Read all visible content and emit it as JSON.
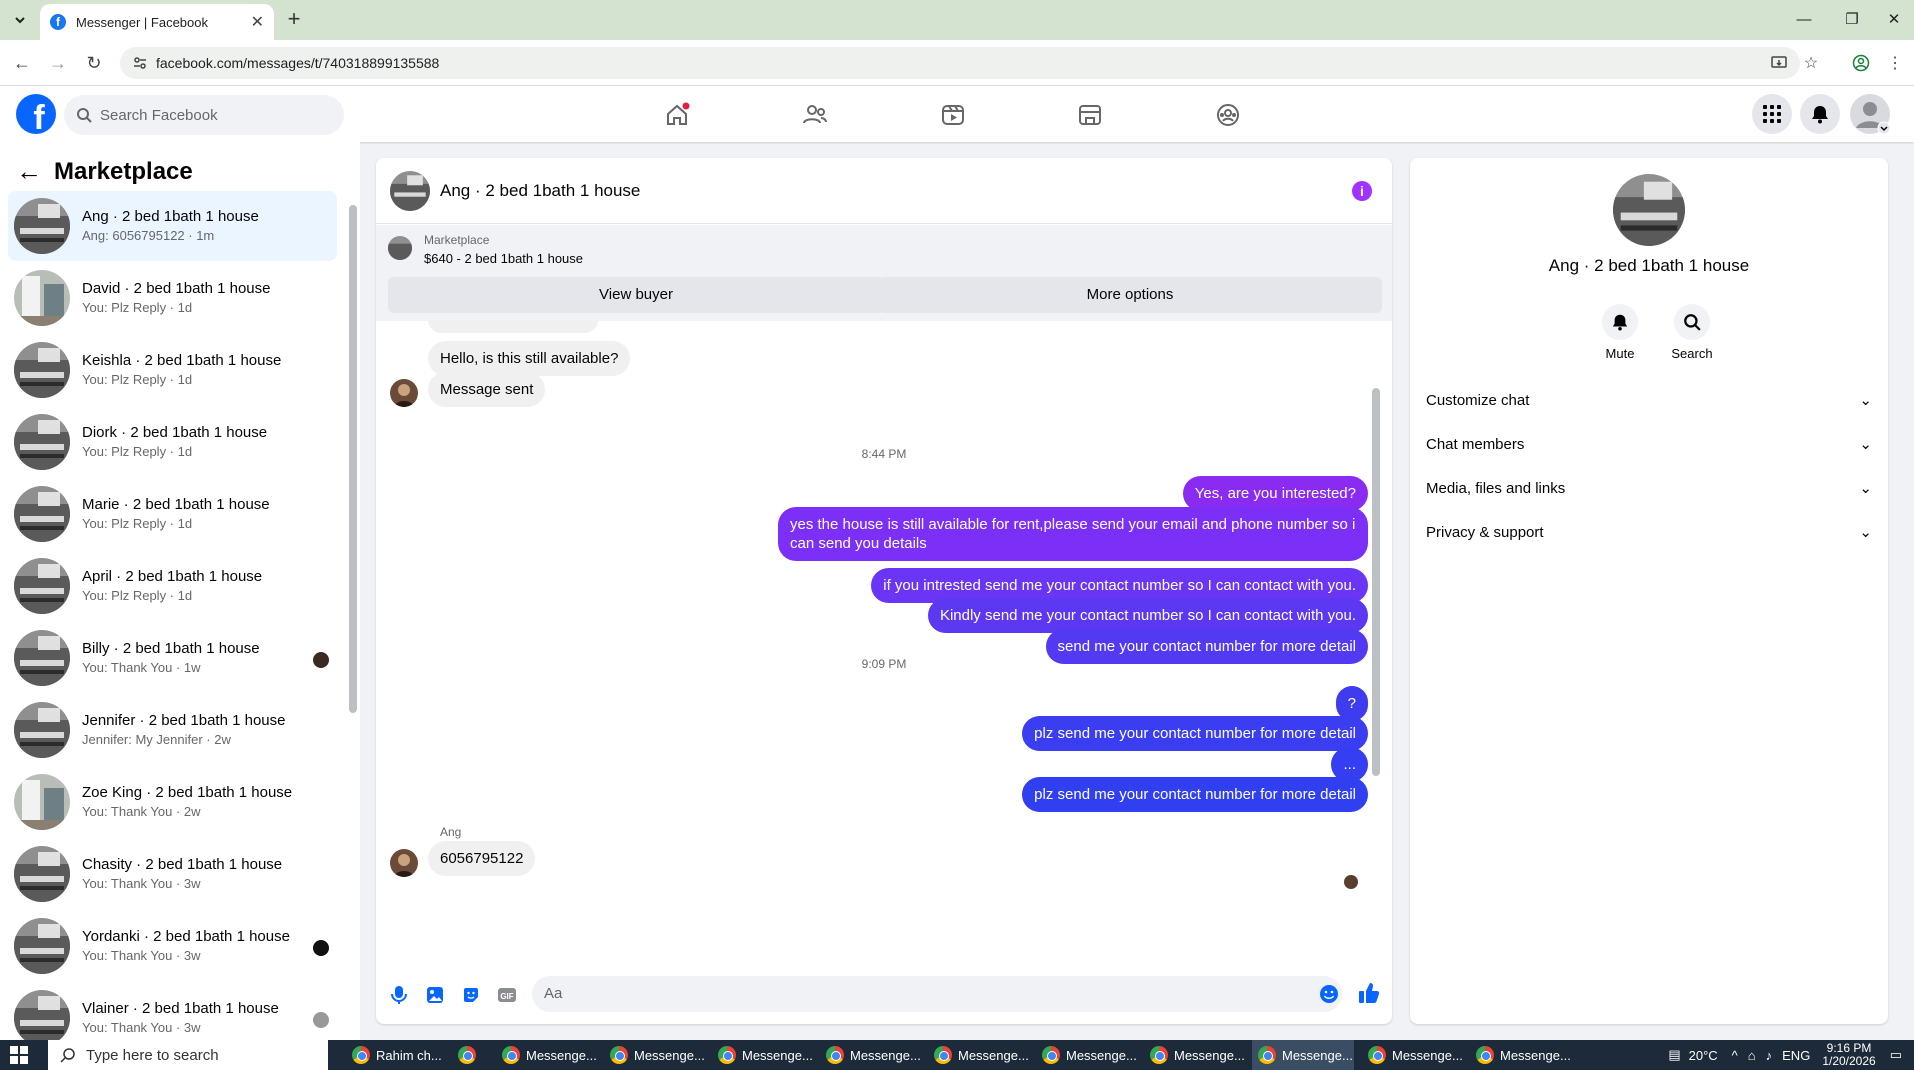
{
  "browser": {
    "tab_title": "Messenger | Facebook",
    "url": "facebook.com/messages/t/740318899135588"
  },
  "facebook": {
    "search_placeholder": "Search Facebook"
  },
  "left_panel": {
    "title": "Marketplace",
    "conversations": [
      {
        "name": "Ang · 2 bed 1bath 1 house",
        "preview": "Ang: 6056795122 · 1m"
      },
      {
        "name": "David · 2 bed 1bath 1 house",
        "preview": "You: Plz Reply · 1d"
      },
      {
        "name": "Keishla · 2 bed 1bath 1 house",
        "preview": "You: Plz Reply · 1d"
      },
      {
        "name": "Diork · 2 bed 1bath 1 house",
        "preview": "You: Plz Reply · 1d"
      },
      {
        "name": "Marie · 2 bed 1bath 1 house",
        "preview": "You: Plz Reply · 1d"
      },
      {
        "name": "April · 2 bed 1bath 1 house",
        "preview": "You: Plz Reply · 1d"
      },
      {
        "name": "Billy · 2 bed 1bath 1 house",
        "preview": "You: Thank You · 1w"
      },
      {
        "name": "Jennifer · 2 bed 1bath 1 house",
        "preview": "Jennifer: My Jennifer · 2w"
      },
      {
        "name": "Zoe King · 2 bed 1bath 1 house",
        "preview": "You: Thank You · 2w"
      },
      {
        "name": "Chasity · 2 bed 1bath 1 house",
        "preview": "You: Thank You · 3w"
      },
      {
        "name": "Yordanki · 2 bed 1bath 1 house",
        "preview": "You: Thank You · 3w"
      },
      {
        "name": "Vlainer · 2 bed 1bath 1 house",
        "preview": "You: Thank You · 3w"
      }
    ]
  },
  "chat": {
    "title": "Ang · 2 bed 1bath 1 house",
    "marketplace_label": "Marketplace",
    "listing": "$640 - 2 bed 1bath 1 house",
    "view_buyer": "View buyer",
    "more_options": "More options",
    "messages": {
      "in1": "Hello, is this still available?",
      "in2": "Message sent",
      "time1": "8:44 PM",
      "out1": "Yes, are you interested?",
      "out2": "yes the house is still available for rent,please send your email and phone number so i can send you details",
      "out3": "if you intrested send me your contact number so I can contact with you.",
      "out4": "Kindly send me your contact number so I can contact with you.",
      "out5": "send me your contact number for more detail",
      "time2": "9:09 PM",
      "out6": "?",
      "out7": "plz send me your contact number for more detail",
      "out8": "...",
      "out9": "plz send me your contact number for more detail",
      "sender": "Ang",
      "in3": "6056795122"
    },
    "composer_placeholder": "Aa"
  },
  "right_panel": {
    "name": "Ang · 2 bed 1bath 1 house",
    "mute": "Mute",
    "search": "Search",
    "sections": [
      "Customize chat",
      "Chat members",
      "Media, files and links",
      "Privacy & support"
    ]
  },
  "taskbar": {
    "search_placeholder": "Type here to search",
    "apps": [
      "Rahim ch...",
      "Messenge...",
      "Messenge...",
      "Messenge...",
      "Messenge...",
      "Messenge...",
      "Messenge...",
      "Messenge...",
      "Messenge...",
      "Messenge...",
      "Messenge..."
    ],
    "temperature": "20°C",
    "language": "ENG",
    "time": "9:16 PM",
    "date": "1/20/2026"
  },
  "colors": {
    "brand_blue": "#0866ff",
    "bubble_purple": "#7b2ff7",
    "bubble_blue": "#3b3bf0",
    "info_purple": "#a033ff"
  }
}
